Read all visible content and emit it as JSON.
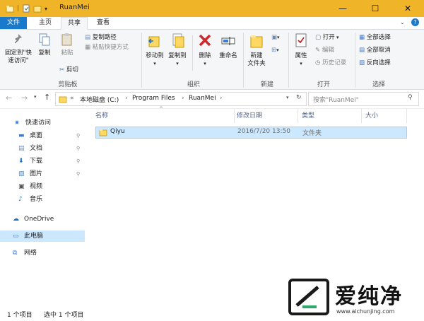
{
  "window": {
    "title": "RuanMei",
    "minimize": "—",
    "maximize": "☐",
    "close": "✕"
  },
  "tabs": [
    "文件",
    "主页",
    "共享",
    "查看"
  ],
  "ribbon": {
    "clipboard": {
      "pin": "固定到\"快\n速访问\"",
      "copy": "复制",
      "paste": "粘贴",
      "copy_path": "复制路径",
      "paste_shortcut": "粘贴快捷方式",
      "cut": "剪切",
      "label": "剪贴板"
    },
    "organize": {
      "move_to": "移动到",
      "copy_to": "复制到",
      "delete": "删除",
      "rename": "重命名",
      "label": "组织"
    },
    "new": {
      "new_folder": "新建\n文件夹",
      "label": "新建"
    },
    "open": {
      "properties": "属性",
      "open": "打开",
      "edit": "编辑",
      "history": "历史记录",
      "label": "打开"
    },
    "select": {
      "select_all": "全部选择",
      "select_none": "全部取消",
      "invert": "反向选择",
      "label": "选择"
    }
  },
  "address": {
    "path": [
      "本地磁盘 (C:)",
      "Program Files",
      "RuanMei"
    ],
    "search_placeholder": "搜索\"RuanMei\""
  },
  "nav": {
    "quick_access": "快速访问",
    "pinned": [
      "桌面",
      "文档",
      "下载",
      "图片"
    ],
    "unpinned": [
      "视频",
      "音乐"
    ],
    "onedrive": "OneDrive",
    "this_pc": "此电脑",
    "network": "网络"
  },
  "columns": [
    "名称",
    "修改日期",
    "类型",
    "大小"
  ],
  "files": [
    {
      "name": "Qiyu",
      "modified": "2016/7/20 13:50",
      "type": "文件夹",
      "size": ""
    }
  ],
  "status": {
    "count": "1 个项目",
    "selected": "选中 1 个项目"
  },
  "watermark": {
    "brand": "爱纯净",
    "url": "www.aichunjing.com"
  },
  "colors": {
    "title_bar": "#f0b429",
    "file_tab": "#1979ca",
    "selection": "#cce8ff"
  }
}
